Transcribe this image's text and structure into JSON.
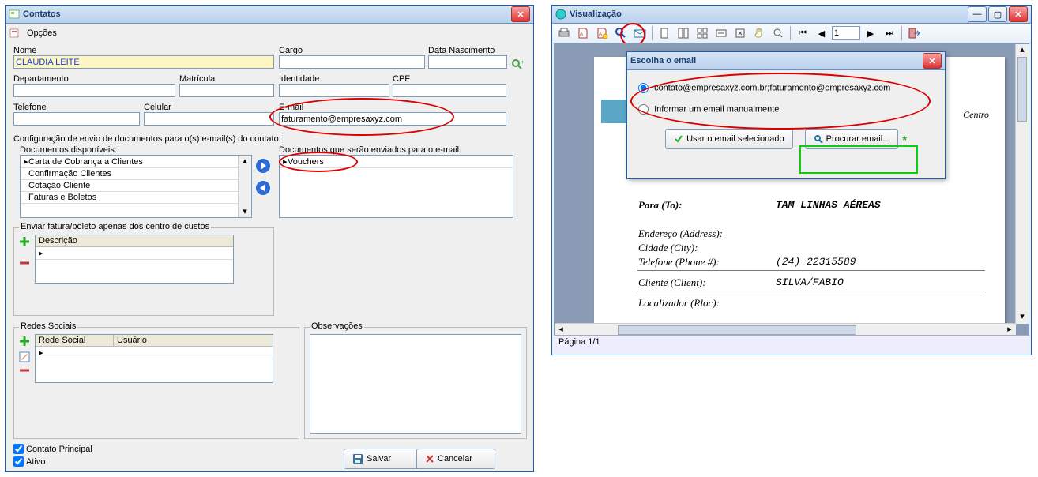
{
  "contatos": {
    "title": "Contatos",
    "menu_options": "Opções",
    "labels": {
      "nome": "Nome",
      "cargo": "Cargo",
      "datanasc": "Data Nascimento",
      "departamento": "Departamento",
      "matricula": "Matrícula",
      "identidade": "Identidade",
      "cpf": "CPF",
      "telefone": "Telefone",
      "celular": "Celular",
      "email": "E-mail",
      "config": "Configuração de envio de documentos para o(s) e-mail(s) do contato:",
      "docsdisp": "Documentos disponíveis:",
      "docssend": "Documentos que serão enviados para o e-mail:",
      "envfatura": "Enviar fatura/boleto apenas dos centro de custos",
      "descricao": "Descrição",
      "redes": "Redes Sociais",
      "redesocial": "Rede Social",
      "usuario": "Usuário",
      "observ": "Observações",
      "contatoprincipal": "Contato Principal",
      "ativo": "Ativo",
      "salvar": "Salvar",
      "cancelar": "Cancelar"
    },
    "values": {
      "nome": "CLAUDIA LEITE",
      "email": "faturamento@empresaxyz.com"
    },
    "docs_disponiveis": [
      "Carta de Cobrança a Clientes",
      "Confirmação Clientes",
      "Cotação Cliente",
      "Faturas e Boletos"
    ],
    "docs_enviados": [
      "Vouchers"
    ]
  },
  "visual": {
    "title": "Visualização",
    "status": "Página 1/1",
    "dialog": {
      "title": "Escolha o email",
      "opt_email": "contato@empresaxyz.com.br;faturamento@empresaxyz.com",
      "opt_manual": "Informar um email manualmente",
      "btn_usar": "Usar o email selecionado",
      "btn_procurar": "Procurar email..."
    },
    "preview": {
      "centro": "Centro",
      "para_lbl": "Para (To):",
      "para_val": "TAM LINHAS AÉREAS",
      "end_lbl": "Endereço (Address):",
      "cidade_lbl": "Cidade (City):",
      "tel_lbl": "Telefone (Phone #):",
      "tel_val": "(24) 22315589",
      "cliente_lbl": "Cliente (Client):",
      "cliente_val": "SILVA/FABIO",
      "loc_lbl": "Localizador (Rloc):"
    }
  }
}
